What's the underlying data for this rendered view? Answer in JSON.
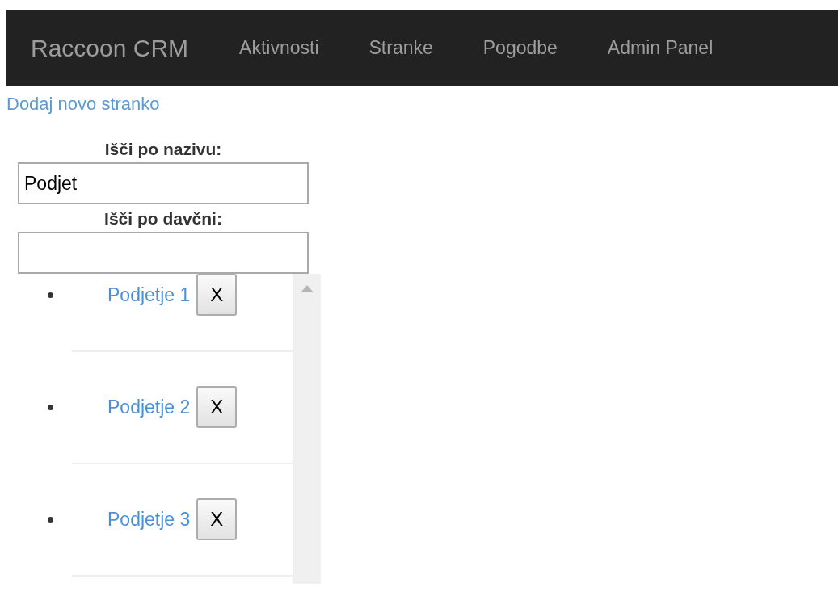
{
  "navbar": {
    "brand": "Raccoon CRM",
    "items": [
      "Aktivnosti",
      "Stranke",
      "Pogodbe",
      "Admin Panel"
    ]
  },
  "add_link": "Dodaj novo stranko",
  "search_fields": [
    {
      "label": "Išči po nazivu:",
      "value": "Podjet"
    },
    {
      "label": "Išči po davčni:"
    }
  ],
  "companies": [
    {
      "name": "Podjetje 1",
      "delete": "X"
    },
    {
      "name": "Podjetje 2",
      "delete": "X"
    },
    {
      "name": "Podjetje 3",
      "delete": "X"
    }
  ]
}
